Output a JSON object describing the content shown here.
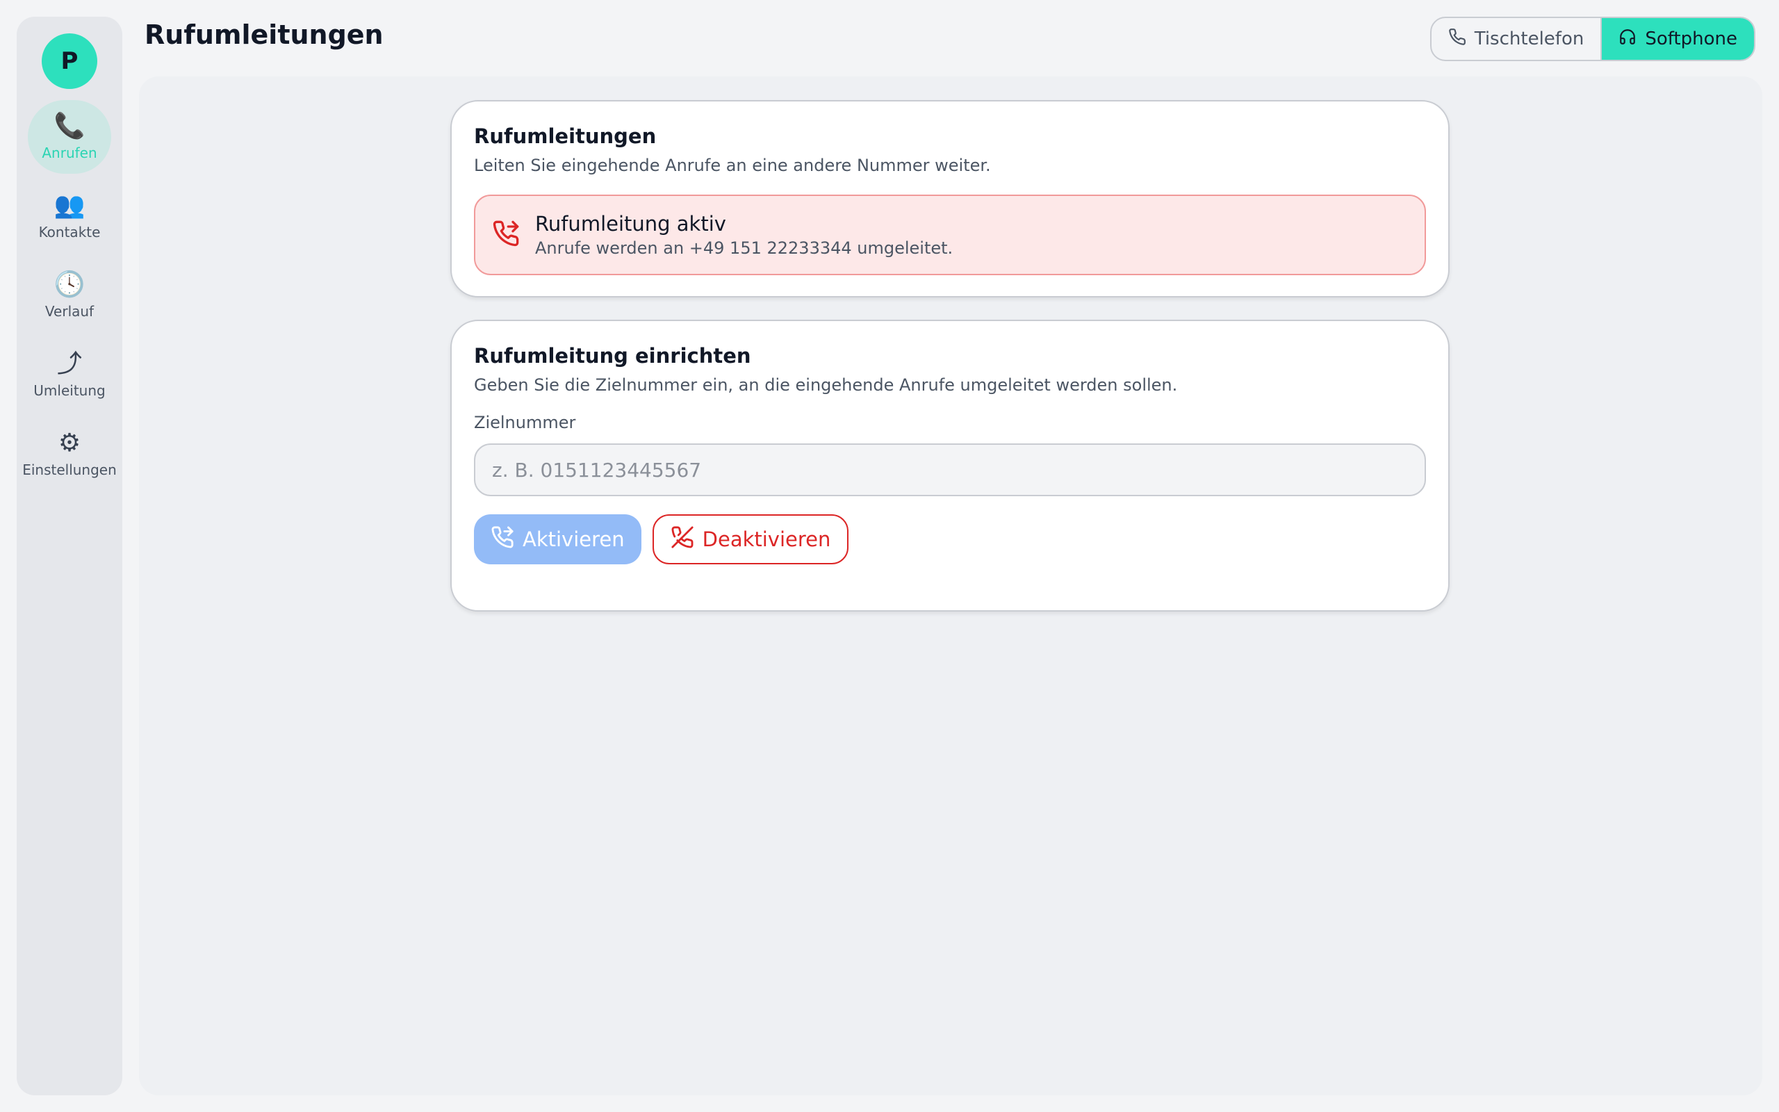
{
  "sidebar": {
    "avatar": "P",
    "items": [
      {
        "label": "Anrufen",
        "icon": "📞",
        "icon_name": "phone-icon"
      },
      {
        "label": "Kontakte",
        "icon": "👥",
        "icon_name": "contacts-icon"
      },
      {
        "label": "Verlauf",
        "icon": "🕓",
        "icon_name": "clock-icon"
      },
      {
        "label": "Umleitung",
        "icon": "⤴",
        "icon_name": "redirect-icon"
      },
      {
        "label": "Einstellungen",
        "icon": "⚙",
        "icon_name": "gear-icon"
      }
    ],
    "active_item": "Anrufen"
  },
  "header": {
    "title": "Rufumleitungen",
    "device_toggle": {
      "options": [
        "Tischtelefon",
        "Softphone"
      ],
      "selected": "Softphone"
    }
  },
  "status_card": {
    "title": "Rufumleitungen",
    "description": "Leiten Sie eingehende Anrufe an eine andere Nummer weiter.",
    "alert": {
      "title": "Rufumleitung aktiv",
      "text": "Anrufe werden an +49 151 22233344 umgeleitet."
    }
  },
  "setup_card": {
    "title": "Rufumleitung einrichten",
    "description": "Geben Sie die Zielnummer ein, an die eingehende Anrufe umgeleitet werden sollen.",
    "field_label": "Zielnummer",
    "field_value": "",
    "field_placeholder": "z. B. 0151123445567",
    "activate_label": "Aktivieren",
    "deactivate_label": "Deaktivieren"
  },
  "colors": {
    "accent": "#2de0bd",
    "alert_bg": "#fde8e8",
    "danger": "#dc2626",
    "activate_disabled": "#93bbf7"
  }
}
